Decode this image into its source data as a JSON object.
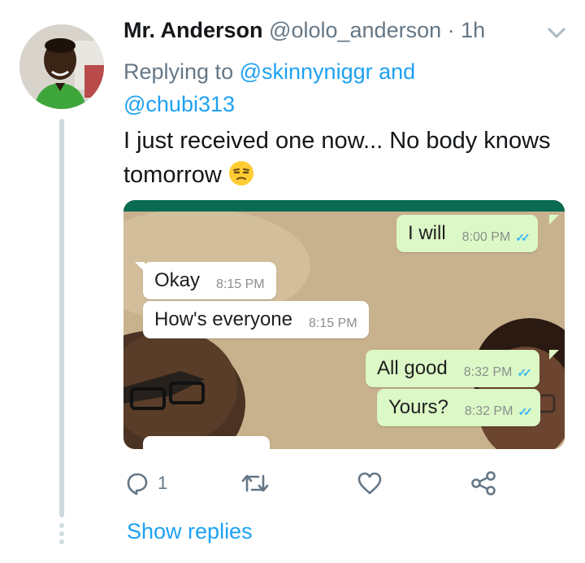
{
  "tweet": {
    "author_name": "Mr. Anderson",
    "author_handle": "@ololo_anderson",
    "separator": "·",
    "time": "1h",
    "replying_prefix": "Replying to",
    "reply_mentions": [
      "@skinnyniggr",
      "@chubi313"
    ],
    "reply_conjunction": "and",
    "text": "I just received one now... No body knows tomorrow",
    "emoji": "unamused-face-emoji"
  },
  "media": {
    "messages": [
      {
        "direction": "out",
        "text": "I will",
        "time": "8:00 PM",
        "status": "read"
      },
      {
        "direction": "in",
        "text": "Okay",
        "time": "8:15 PM"
      },
      {
        "direction": "in",
        "text": "How's everyone",
        "time": "8:15 PM"
      },
      {
        "direction": "out",
        "text": "All good",
        "time": "8:32 PM",
        "status": "read"
      },
      {
        "direction": "out",
        "text": "Yours?",
        "time": "8:32 PM",
        "status": "read"
      }
    ],
    "ticks_glyph": "✓✓"
  },
  "actions": {
    "reply_count": "1",
    "icons": [
      "reply-icon",
      "retweet-icon",
      "like-icon",
      "share-icon"
    ]
  },
  "show_replies_label": "Show replies",
  "colors": {
    "twitter_blue": "#1da1f2",
    "secondary_text": "#657786",
    "whatsapp_outgoing": "#dcf8c6",
    "whatsapp_read_ticks": "#34b7f1"
  }
}
